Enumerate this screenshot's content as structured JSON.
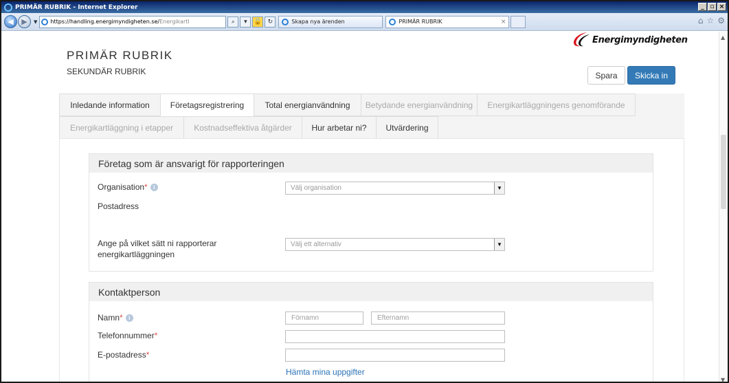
{
  "browser": {
    "window_title": "PRIMÄR RUBRIK - Internet Explorer",
    "url_bold": "https://handling.energimyndigheten.se/",
    "url_grey": "Energikartl",
    "tab1_title": "Skapa nya ärenden",
    "tab2_title": "PRIMÄR RUBRIK"
  },
  "header": {
    "logo_text": "Energimyndigheten",
    "primary_title": "PRIMÄR RUBRIK",
    "secondary_title": "SEKUNDÄR RUBRIK",
    "save_label": "Spara",
    "submit_label": "Skicka in"
  },
  "tabs_row1": [
    {
      "label": "Inledande information",
      "state": "normal"
    },
    {
      "label": "Företagsregistrering",
      "state": "active"
    },
    {
      "label": "Total energianvändning",
      "state": "normal"
    },
    {
      "label": "Betydande energianvändning",
      "state": "disabled"
    },
    {
      "label": "Energikartläggningens genomförande",
      "state": "disabled"
    }
  ],
  "tabs_row2": [
    {
      "label": "Energikartläggning i etapper",
      "state": "disabled"
    },
    {
      "label": "Kostnadseffektiva åtgärder",
      "state": "disabled"
    },
    {
      "label": "Hur arbetar ni?",
      "state": "normal"
    },
    {
      "label": "Utvärdering",
      "state": "normal"
    }
  ],
  "company_section": {
    "title": "Företag som är ansvarigt för rapporteringen",
    "organisation_label": "Organisation",
    "organisation_placeholder": "Välj organisation",
    "address_label": "Postadress",
    "report_method_label_line1": "Ange på vilket sätt ni rapporterar",
    "report_method_label_line2": "energikartläggningen",
    "report_method_placeholder": "Välj ett alternativ"
  },
  "contact_section": {
    "title": "Kontaktperson",
    "name_label": "Namn",
    "firstname_placeholder": "Förnamn",
    "lastname_placeholder": "Efternamn",
    "phone_label": "Telefonnummer",
    "email_label": "E-postadress",
    "fetch_link": "Hämta mina uppgifter"
  },
  "required_marker": "*",
  "info_glyph": "i",
  "colors": {
    "primary_button": "#337ab7",
    "required": "#d9534f",
    "link": "#2a72b5",
    "logo_red": "#d7141e"
  }
}
